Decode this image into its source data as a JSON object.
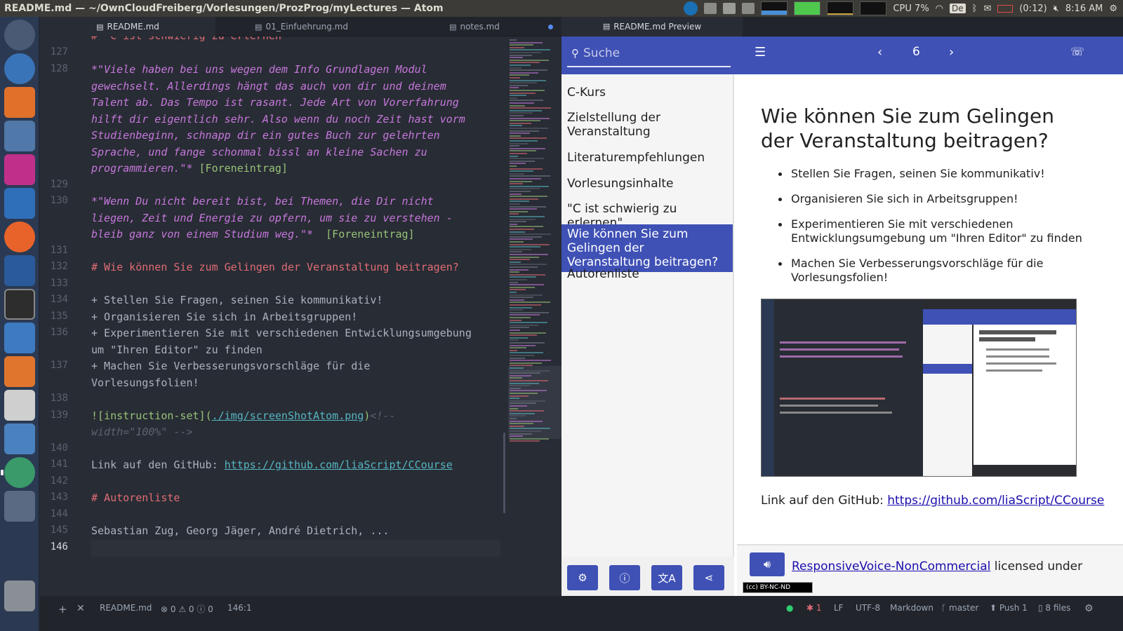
{
  "window": {
    "title": "README.md — ~/OwnCloudFreiberg/Vorlesungen/ProzProg/myLectures — Atom"
  },
  "tray": {
    "cpu": "CPU 7%",
    "kbd": "De",
    "battery": "(0:12)",
    "time": "8:16 AM"
  },
  "tabs": [
    {
      "label": "README.md",
      "icon": "markdown-icon"
    },
    {
      "label": "01_Einfuehrung.md",
      "icon": "markdown-icon"
    },
    {
      "label": "notes.md",
      "icon": "markdown-icon"
    }
  ],
  "preview_tab": {
    "label": "README.md Preview"
  },
  "code": {
    "line126": "#  C ist schwierig zu erlernen\"",
    "lines": [
      {
        "n": "127"
      },
      {
        "n": "128"
      },
      {
        "n": "129"
      },
      {
        "n": "130"
      },
      {
        "n": "131"
      },
      {
        "n": "132"
      },
      {
        "n": "133"
      },
      {
        "n": "134"
      },
      {
        "n": "135"
      },
      {
        "n": "136"
      },
      {
        "n": "137"
      },
      {
        "n": "138"
      },
      {
        "n": "139"
      },
      {
        "n": "140"
      },
      {
        "n": "141"
      },
      {
        "n": "142"
      },
      {
        "n": "143"
      },
      {
        "n": "144"
      },
      {
        "n": "145"
      },
      {
        "n": "146"
      }
    ],
    "q1": [
      "*\"Viele haben bei uns wegen dem Info Grundlagen Modul",
      "gewechselt. Allerdings hängt das auch von dir und deinem",
      "Talent ab. Das Tempo ist rasant. Jede Art von Vorerfahrung",
      "hilft dir eigentlich sehr. Also wenn du noch Zeit hast vorm",
      "Studienbeginn, schnapp dir ein gutes Buch zur gelehrten",
      "Sprache, und fange schonmal bissl an kleine Sachen zu",
      "programmieren.\"*"
    ],
    "q1_tag": " [Foreneintrag]",
    "q2": [
      "*\"Wenn Du nicht bereit bist, bei Themen, die Dir nicht",
      "liegen, Zeit und Energie zu opfern, um sie zu verstehen -",
      "bleib ganz von einem Studium weg.\"*"
    ],
    "q2_tag": "  [Foreneintrag]",
    "h132": "# Wie können Sie zum Gelingen der Veranstaltung beitragen?",
    "l134": "+ Stellen Sie Fragen, seinen Sie kommunikativ!",
    "l135": "+ Organisieren Sie sich in Arbeitsgruppen!",
    "l136a": "+ Experimentieren Sie mit verschiedenen Entwicklungsumgebung",
    "l136b": "um \"Ihren Editor\" zu finden",
    "l137a": "+ Machen Sie Verbesserungsvorschläge für die",
    "l137b": "Vorlesungsfolien!",
    "img_alt": "![instruction-set]",
    "img_path": "(./img/screenShotAtom.png)",
    "img_path_text": "./img/screenShotAtom.png",
    "img_comment_a": "<!--",
    "img_comment_b": "width=\"100%\" -->",
    "l141_text": "Link auf den GitHub: ",
    "l141_link": "https://github.com/liaScript/CCourse",
    "h143": "# Autorenliste",
    "l145": "Sebastian Zug, Georg Jäger, André Dietrich, ..."
  },
  "preview": {
    "search_placeholder": "Suche",
    "page": "6",
    "toc": [
      "C-Kurs",
      "Zielstellung der Veranstaltung",
      "Literaturempfehlungen",
      "Vorlesungsinhalte",
      "\"C ist schwierig zu erlernen\"",
      "Wie können Sie zum Gelingen der Veranstaltung beitragen?",
      "Autorenliste"
    ],
    "heading": "Wie können Sie zum Gelingen der Veranstaltung beitragen?",
    "bullets": [
      "Stellen Sie Fragen, seinen Sie kommunikativ!",
      "Organisieren Sie sich in Arbeitsgruppen!",
      "Experimentieren Sie mit verschiedenen Entwicklungsumgebung um \"Ihren Editor\" zu finden",
      "Machen Sie Verbesserungsvorschläge für die Vorlesungsfolien!"
    ],
    "link_text": "Link auf den GitHub: ",
    "link_url": "https://github.com/liaScript/CCourse",
    "voice_link": "ResponsiveVoice-NonCommercial",
    "voice_suffix": " licensed under",
    "cc_badge": "(cc) BY-NC-ND"
  },
  "status": {
    "file": "README.md",
    "diagnostics": "⊗ 0 ⚠ 0 ⓘ 0",
    "cursor": "146:1",
    "issues": "1",
    "eol": "LF",
    "encoding": "UTF-8",
    "grammar": "Markdown",
    "branch": "master",
    "push": "Push 1",
    "files": "8 files"
  },
  "colors": {
    "accent": "#3f51b5",
    "editor_bg": "#282c34",
    "launcher_bg": "#2b3a52"
  }
}
